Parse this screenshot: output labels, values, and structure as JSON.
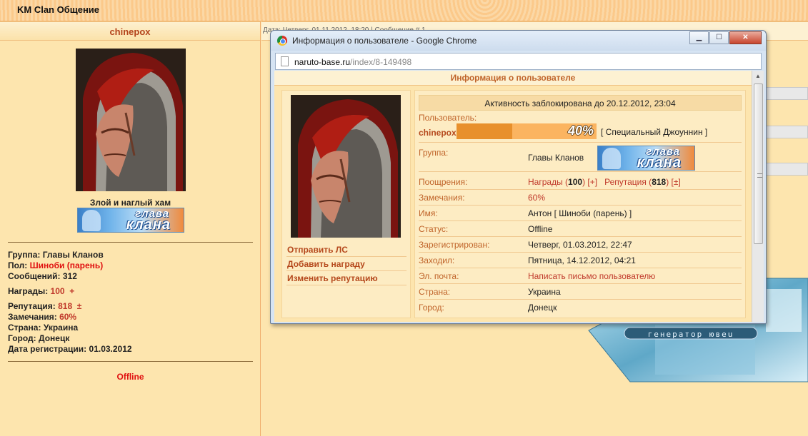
{
  "forum": {
    "title": "KM Clan Общение"
  },
  "left": {
    "username": "chinepox",
    "quote": "Злой и наглый хам",
    "rank_badge": {
      "top": "глава",
      "bottom": "клана"
    },
    "group_label": "Группа:",
    "group_value": "Главы Кланов",
    "gender_label": "Пол:",
    "gender_value": "Шиноби (парень)",
    "posts_label": "Сообщений:",
    "posts_value": "312",
    "awards_label": "Награды:",
    "awards_value": "100",
    "awards_plus": "+",
    "rep_label": "Репутация:",
    "rep_value": "818",
    "rep_pm": "±",
    "warn_label": "Замечания:",
    "warn_value": "60%",
    "country_label": "Страна:",
    "country_value": "Украина",
    "city_label": "Город:",
    "city_value": "Донецк",
    "regdate_label": "Дата регистрации:",
    "regdate_value": "01.03.2012",
    "status": "Offline"
  },
  "right_header": {
    "text": "Дата: Четверг, 01.11.2012, 18:20 | Сообщение # 1"
  },
  "popup": {
    "window_title": "Информация о пользователе - Google Chrome",
    "buttons": {
      "minimize": "▁",
      "maximize": "☐",
      "close": "✕"
    },
    "url_host": "naruto-base.ru",
    "url_path": "/index/8-149498",
    "header": "Информация о пользователе",
    "actions": [
      "Отправить ЛС",
      "Добавить награду",
      "Изменить репутацию"
    ],
    "blocked": "Активность заблокирована до 20.12.2012, 23:04",
    "user_label": "Пользователь:",
    "username": "chinepox",
    "progress_pct": "40%",
    "progress_value": 0.4,
    "rank": "[ Специальный Джоуннин ]",
    "group_label": "Группа:",
    "group_value": "Главы Кланов",
    "rank_badge": {
      "top": "глава",
      "bottom": "клана"
    },
    "incent_label": "Поощрения:",
    "awards_text": "Награды (",
    "awards_num": "100",
    "awards_close": ") [+]",
    "rep_text": "Репутация (",
    "rep_num": "818",
    "rep_close": ") [±]",
    "warn_label": "Замечания:",
    "warn_value": "60%",
    "name_label": "Имя:",
    "name_value": "Антон [ Шиноби (парень) ]",
    "status_label": "Статус:",
    "status_value": "Offline",
    "reg_label": "Зарегистрирован:",
    "reg_value": "Четверг, 01.03.2012, 22:47",
    "visit_label": "Заходил:",
    "visit_value": "Пятница, 14.12.2012, 04:21",
    "email_label": "Эл. почта:",
    "email_value": "Написать письмо пользователю",
    "country_label": "Страна:",
    "country_value": "Украина",
    "city_label": "Город:",
    "city_value": "Донецк"
  },
  "collage_text": "генератор ювеu",
  "colors": {
    "accent": "#c0642a",
    "link": "#c0392b",
    "offline": "#e01010",
    "bg": "#fde5ae"
  }
}
